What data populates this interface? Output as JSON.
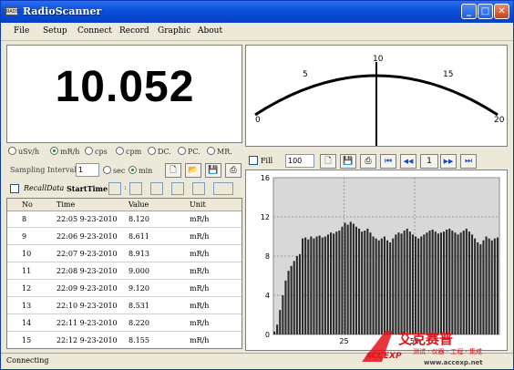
{
  "window": {
    "title": "RadioScanner",
    "app_icon_text": "RADS"
  },
  "menu": [
    "File",
    "Setup",
    "Connect",
    "Record",
    "Graphic",
    "About"
  ],
  "reading": {
    "value": "10.052"
  },
  "meter": {
    "scale": [
      "0",
      "5",
      "10",
      "15",
      "20"
    ],
    "needle_value": 10,
    "max": 20
  },
  "units": {
    "options": [
      {
        "label": "uSv/h",
        "selected": false
      },
      {
        "label": "mR/h",
        "selected": true
      },
      {
        "label": "cps",
        "selected": false
      },
      {
        "label": "cpm",
        "selected": false
      },
      {
        "label": "DC.",
        "selected": false
      },
      {
        "label": "PC.",
        "selected": false
      },
      {
        "label": "MR.",
        "selected": false
      }
    ]
  },
  "sampling": {
    "label": "Sampling Interval",
    "value": "1",
    "sec_label": "sec",
    "min_label": "min",
    "selected": "min"
  },
  "recall": {
    "label": "RecallData",
    "start_label": "StartTime",
    "sep": ":"
  },
  "table": {
    "headers": [
      "No",
      "Time",
      "Value",
      "Unit"
    ],
    "rows": [
      [
        "8",
        "22:05 9-23-2010",
        "8.120",
        "mR/h"
      ],
      [
        "9",
        "22:06 9-23-2010",
        "8.611",
        "mR/h"
      ],
      [
        "10",
        "22:07 9-23-2010",
        "8.913",
        "mR/h"
      ],
      [
        "11",
        "22:08 9-23-2010",
        "9.000",
        "mR/h"
      ],
      [
        "12",
        "22:09 9-23-2010",
        "9.120",
        "mR/h"
      ],
      [
        "13",
        "22:10 9-23-2010",
        "8.531",
        "mR/h"
      ],
      [
        "14",
        "22:11 9-23-2010",
        "8.220",
        "mR/h"
      ],
      [
        "15",
        "22:12 9-23-2010",
        "8.155",
        "mR/h"
      ]
    ]
  },
  "graph_toolbar": {
    "fill_label": "Fill",
    "count": "100",
    "page": "1",
    "first": "⏮",
    "prev": "◀◀",
    "next": "▶▶",
    "last": "⏭"
  },
  "chart_data": {
    "type": "bar",
    "x_ticks": [
      "25",
      "50"
    ],
    "y_ticks": [
      "0",
      "4",
      "8",
      "12",
      "16"
    ],
    "ylim": [
      0,
      16
    ],
    "xlim": [
      0,
      80
    ],
    "bar_color": "#2b2b2b",
    "values": [
      0.3,
      1,
      2.5,
      4,
      5.5,
      6.5,
      7,
      7.5,
      8,
      8.2,
      9.8,
      9.9,
      9.7,
      10,
      9.8,
      10,
      10.1,
      9.9,
      10,
      10.2,
      10.4,
      10.3,
      10.5,
      10.6,
      11,
      11.4,
      11.2,
      11.5,
      11.3,
      11,
      10.8,
      10.5,
      10.6,
      10.8,
      10.4,
      10,
      9.8,
      9.6,
      9.8,
      10,
      9.6,
      9.4,
      9.8,
      10.2,
      10.4,
      10.3,
      10.6,
      10.8,
      10.5,
      10.2,
      10,
      9.8,
      10,
      10.2,
      10.4,
      10.6,
      10.7,
      10.5,
      10.3,
      10.4,
      10.5,
      10.7,
      10.8,
      10.6,
      10.4,
      10.2,
      10.4,
      10.6,
      10.8,
      10.5,
      10.2,
      9.8,
      9.4,
      9.2,
      9.6,
      10,
      9.8,
      9.6,
      9.8,
      9.9
    ]
  },
  "status": {
    "text": "Connecting"
  },
  "watermark": {
    "brand": "艾克赛普",
    "logo": "ACCEXP",
    "subtitle": "测试 · 仪器 · 工程 · 集成",
    "url": "www.accexp.net"
  }
}
